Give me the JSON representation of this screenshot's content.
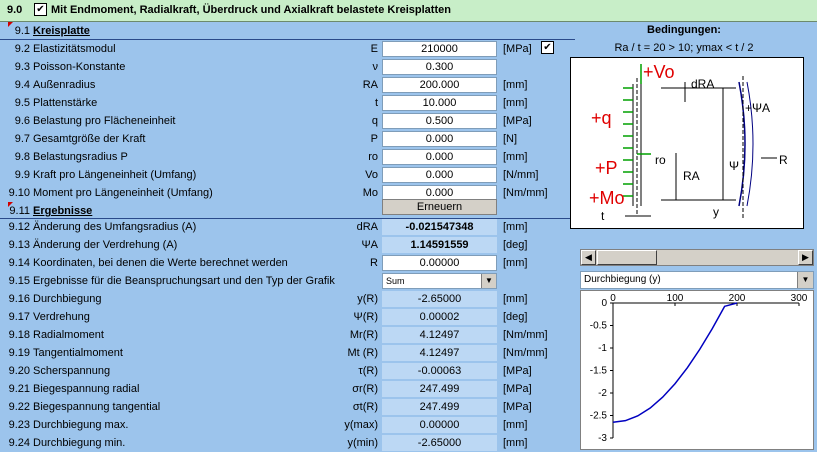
{
  "header": {
    "num": "9.0",
    "checkbox": "✔",
    "title": "Mit Endmoment, Radialkraft, Überdruck und Axialkraft belastete Kreisplatten"
  },
  "sections": {
    "plate": {
      "num": "9.1",
      "label": "Kreisplatte"
    },
    "results": {
      "num": "9.11",
      "label": "Ergebnisse"
    }
  },
  "inputs": [
    {
      "num": "9.2",
      "label": "Elastizitätsmodul",
      "sym": "E",
      "value": "210000",
      "unit": "[MPa]"
    },
    {
      "num": "9.3",
      "label": "Poisson-Konstante",
      "sym": "ν",
      "value": "0.300",
      "unit": ""
    },
    {
      "num": "9.4",
      "label": "Außenradius",
      "sym": "RA",
      "value": "200.000",
      "unit": "[mm]"
    },
    {
      "num": "9.5",
      "label": "Plattenstärke",
      "sym": "t",
      "value": "10.000",
      "unit": "[mm]"
    },
    {
      "num": "9.6",
      "label": "Belastung pro Flächeneinheit",
      "sym": "q",
      "value": "0.500",
      "unit": "[MPa]"
    },
    {
      "num": "9.7",
      "label": "Gesamtgröße der Kraft",
      "sym": "P",
      "value": "0.000",
      "unit": "[N]"
    },
    {
      "num": "9.8",
      "label": "Belastungsradius P",
      "sym": "ro",
      "value": "0.000",
      "unit": "[mm]"
    },
    {
      "num": "9.9",
      "label": "Kraft pro Längeneinheit (Umfang)",
      "sym": "Vo",
      "value": "0.000",
      "unit": "[N/mm]"
    },
    {
      "num": "9.10",
      "label": "Moment pro Längeneinheit (Umfang)",
      "sym": "Mo",
      "value": "0.000",
      "unit": "[Nm/mm]"
    }
  ],
  "renew_button": "Erneuern",
  "unit_checkbox": "✔",
  "results": [
    {
      "num": "9.12",
      "label": "Änderung des Umfangsradius (A)",
      "sym": "dRA",
      "value": "-0.021547348",
      "unit": "[mm]"
    },
    {
      "num": "9.13",
      "label": "Änderung der Verdrehung (A)",
      "sym": "ΨA",
      "value": "1.14591559",
      "unit": "[deg]"
    },
    {
      "num": "9.14",
      "label": "Koordinaten, bei denen die Werte berechnet werden",
      "sym": "R",
      "value": "0.00000",
      "unit": "[mm]"
    }
  ],
  "graph_type": {
    "num": "9.15",
    "label": "Ergebnisse für die Beanspruchungsart und den Typ der Grafik",
    "value": "Sum"
  },
  "outputs": [
    {
      "num": "9.16",
      "label": "Durchbiegung",
      "sym": "y(R)",
      "value": "-2.65000",
      "unit": "[mm]"
    },
    {
      "num": "9.17",
      "label": "Verdrehung",
      "sym": "Ψ(R)",
      "value": "0.00002",
      "unit": "[deg]"
    },
    {
      "num": "9.18",
      "label": "Radialmoment",
      "sym": "Mr(R)",
      "value": "4.12497",
      "unit": "[Nm/mm]"
    },
    {
      "num": "9.19",
      "label": "Tangentialmoment",
      "sym": "Mt (R)",
      "value": "4.12497",
      "unit": "[Nm/mm]"
    },
    {
      "num": "9.20",
      "label": "Scherspannung",
      "sym": "τ(R)",
      "value": "-0.00063",
      "unit": "[MPa]"
    },
    {
      "num": "9.21",
      "label": "Biegespannung radial",
      "sym": "σr(R)",
      "value": "247.499",
      "unit": "[MPa]"
    },
    {
      "num": "9.22",
      "label": "Biegespannung tangential",
      "sym": "σt(R)",
      "value": "247.499",
      "unit": "[MPa]"
    },
    {
      "num": "9.23",
      "label": "Durchbiegung max.",
      "sym": "y(max)",
      "value": "0.00000",
      "unit": "[mm]"
    },
    {
      "num": "9.24",
      "label": "Durchbiegung min.",
      "sym": "y(min)",
      "value": "-2.65000",
      "unit": "[mm]"
    }
  ],
  "conditions": {
    "title": "Bedingungen:",
    "text": "Ra / t = 20 > 10;  ymax < t / 2"
  },
  "diagram_labels": {
    "Vo": "+Vo",
    "dRA": "dRA",
    "q": "+q",
    "psiA": "+ΨA",
    "P": "+P",
    "ro": "ro",
    "RA": "RA",
    "psi": "Ψ",
    "R": "R",
    "Mo": "+Mo",
    "t": "t",
    "y": "y"
  },
  "chart_select": "Durchbiegung (y)",
  "chart_data": {
    "type": "line",
    "title": "",
    "xlabel": "",
    "ylabel": "",
    "xlim": [
      0,
      300
    ],
    "ylim": [
      -3,
      0
    ],
    "xticks": [
      "0",
      "100",
      "200",
      "300"
    ],
    "yticks": [
      "0",
      "-0.5",
      "-1",
      "-1.5",
      "-2",
      "-2.5",
      "-3"
    ],
    "series": [
      {
        "color": "#0000c0",
        "x": [
          0,
          20,
          40,
          60,
          80,
          100,
          120,
          140,
          160,
          180,
          200
        ],
        "y": [
          -2.65,
          -2.615,
          -2.508,
          -2.334,
          -2.094,
          -1.794,
          -1.437,
          -1.028,
          -0.572,
          -0.074,
          0.0
        ]
      }
    ]
  }
}
